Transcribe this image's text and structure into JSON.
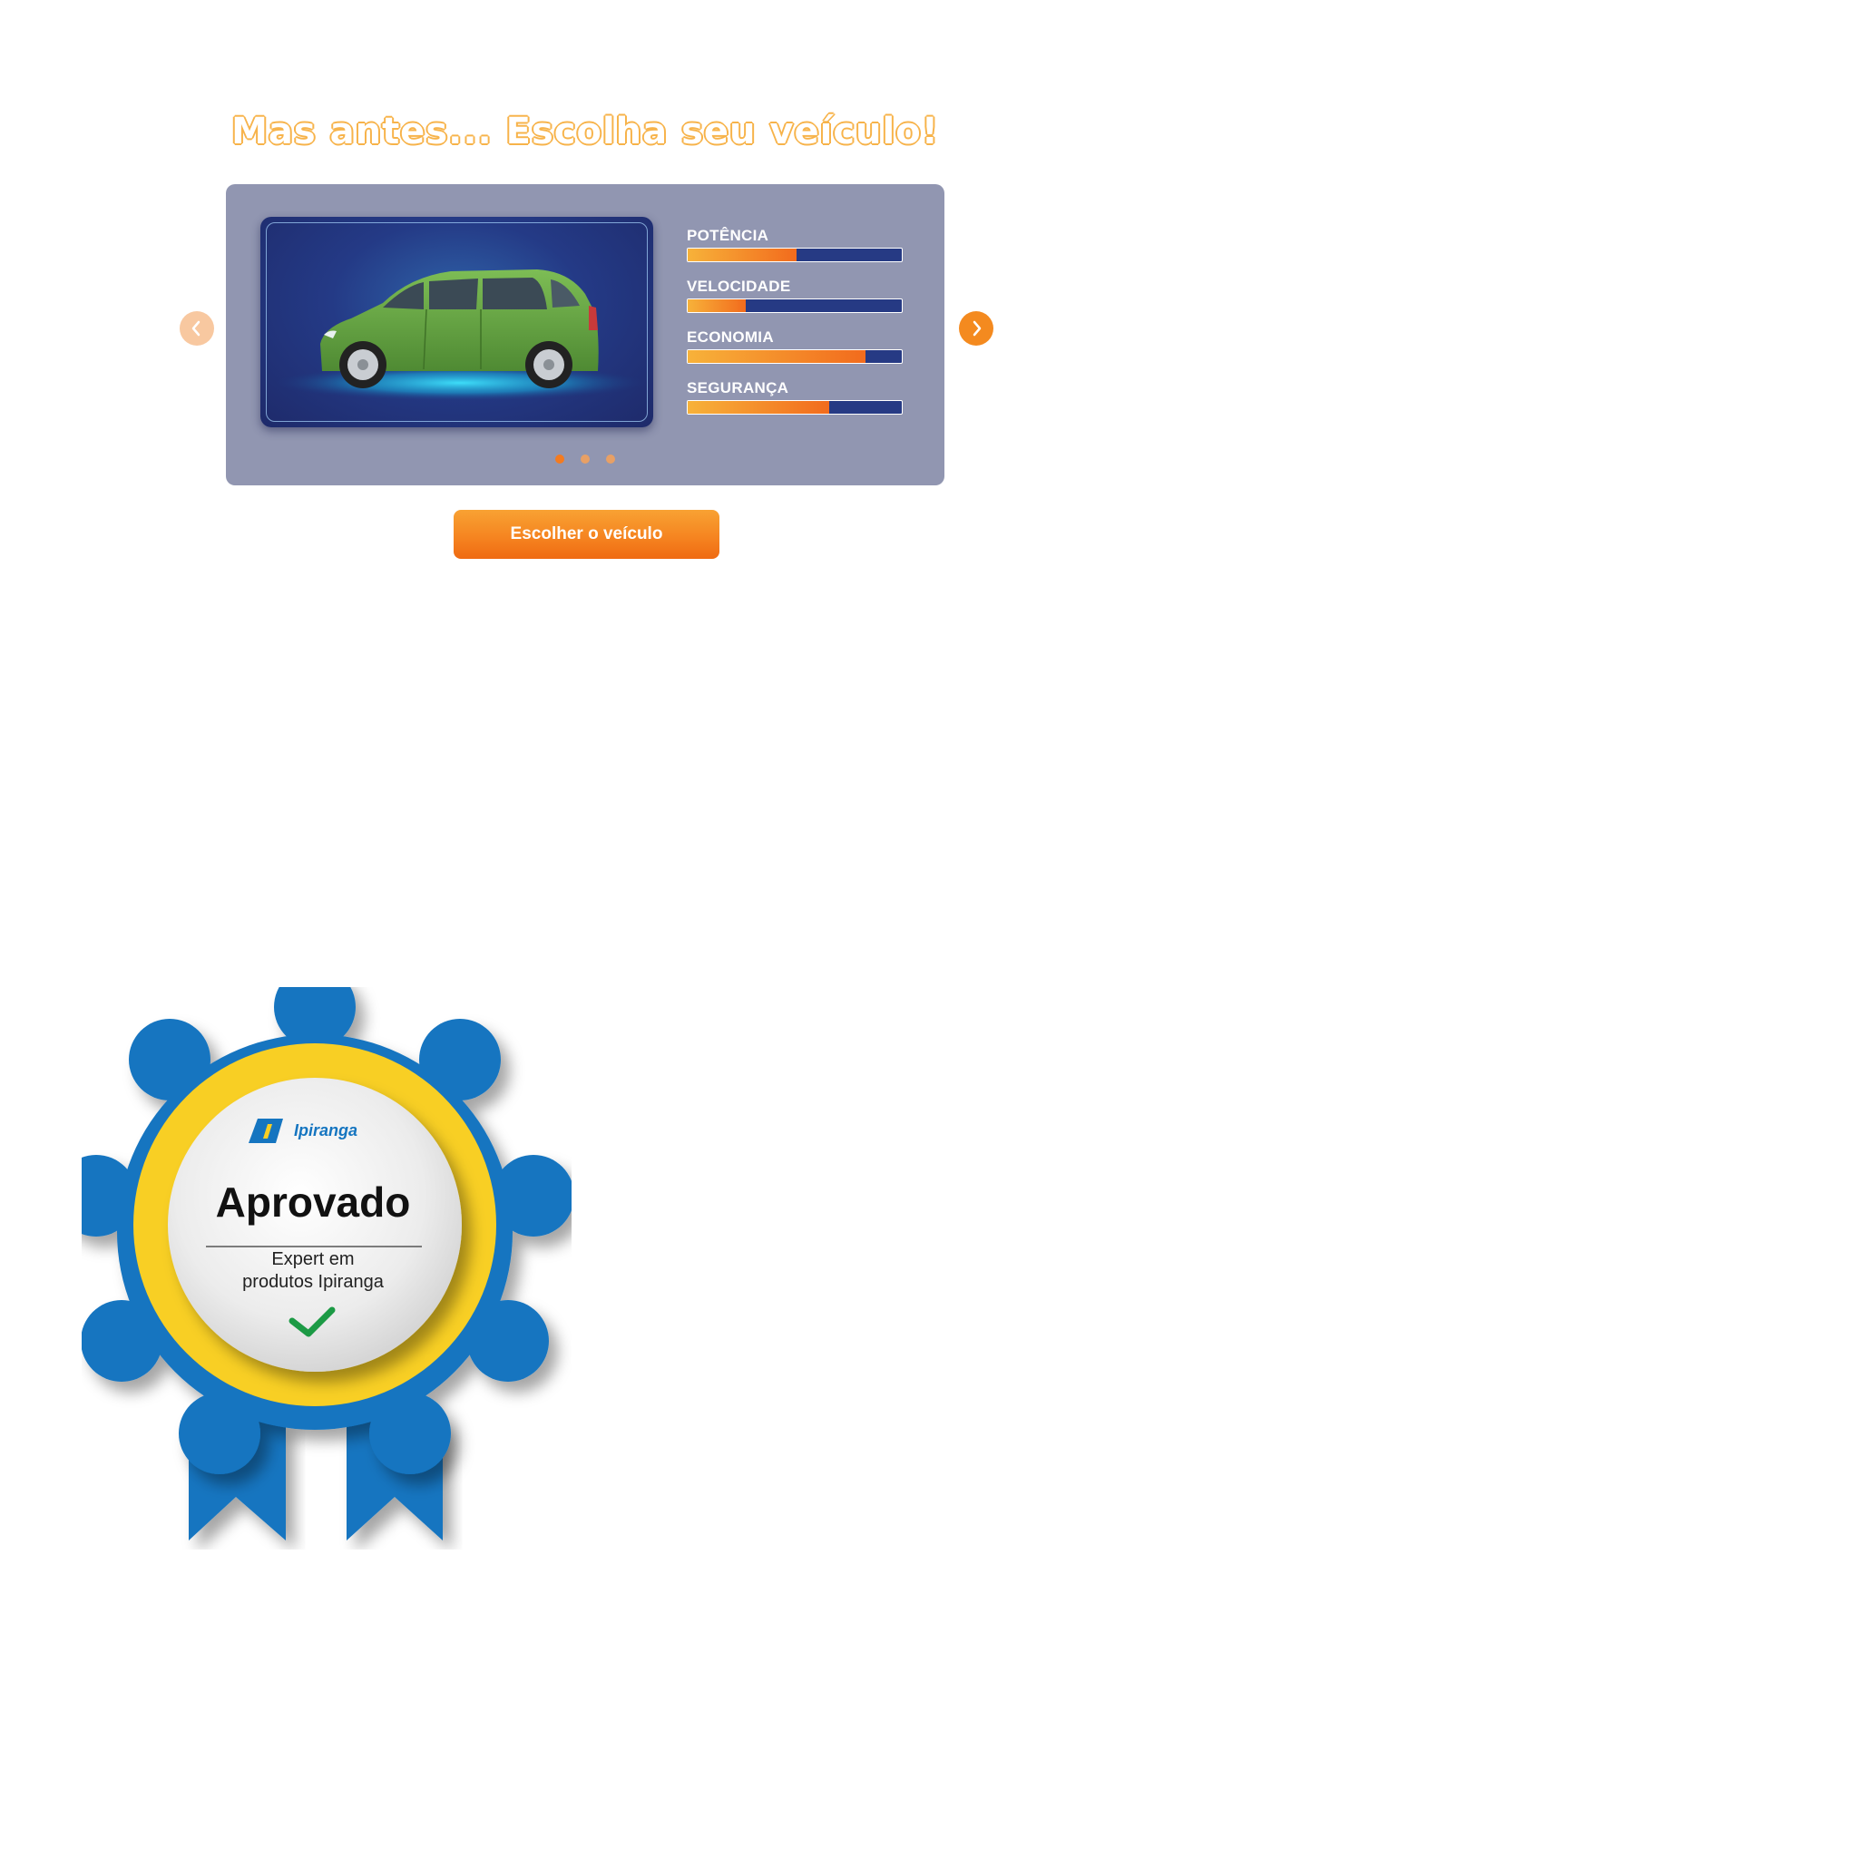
{
  "title": "Mas antes... Escolha seu veículo!",
  "stats": [
    {
      "label": "POTÊNCIA",
      "value": 0.51
    },
    {
      "label": "VELOCIDADE",
      "value": 0.27
    },
    {
      "label": "ECONOMIA",
      "value": 0.83
    },
    {
      "label": "SEGURANÇA",
      "value": 0.66
    }
  ],
  "carousel": {
    "total_slides": 3,
    "active_slide": 1
  },
  "button": {
    "label": "Escolher o veículo"
  },
  "badge": {
    "brand": "Ipiranga",
    "title": "Aprovado",
    "subtitle_line1": "Expert em",
    "subtitle_line2": "produtos Ipiranga"
  },
  "colors": {
    "accent": "#f47b20",
    "panel": "#9196b1",
    "bar_track": "#263a84",
    "badge_blue": "#1575c0",
    "badge_yellow": "#f8cf24",
    "car": "#6aa845"
  }
}
